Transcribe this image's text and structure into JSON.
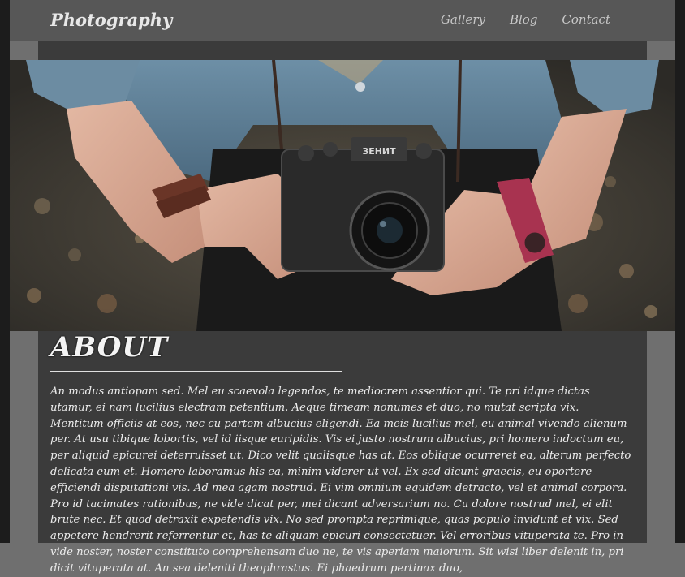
{
  "brand": "Photography",
  "nav": {
    "gallery": "Gallery",
    "blog": "Blog",
    "contact": "Contact"
  },
  "hero": {
    "camera_brand": "ЗЕНИТ"
  },
  "about": {
    "title": "ABOUT",
    "body": "An modus antiopam sed. Mel eu scaevola legendos, te mediocrem assentior qui. Te pri idque dictas utamur, ei nam lucilius electram petentium. Aeque timeam nonumes et duo, no mutat scripta vix. Mentitum officiis at eos, nec cu partem albucius eligendi. Ea meis lucilius mel, eu animal vivendo alienum per. At usu tibique lobortis, vel id iisque euripidis. Vis ei justo nostrum albucius, pri homero indoctum eu, per aliquid epicurei deterruisset ut. Dico velit qualisque has at. Eos oblique ocurreret ea, alterum perfecto delicata eum et. Homero laboramus his ea, minim viderer ut vel. Ex sed dicunt graecis, eu oportere efficiendi disputationi vis. Ad mea agam nostrud. Ei vim omnium equidem detracto, vel et animal corpora. Pro id tacimates rationibus, ne vide dicat per, mei dicant adversarium no. Cu dolore nostrud mel, ei elit brute nec. Et quod detraxit expetendis vix. No sed prompta reprimique, quas populo invidunt et vix. Sed appetere hendrerit referrentur et, has te aliquam epicuri consectetuer. Vel erroribus vituperata te. Pro in vide noster, noster constituto comprehensam duo ne, te vis aperiam maiorum. Sit wisi liber delenit in, pri dicit vituperata at. An sea deleniti theophrastus. Ei phaedrum pertinax duo,"
  },
  "colors": {
    "navbar_bg": "#575757",
    "page_bg": "#6f6f6f",
    "content_bg": "#3b3b3b",
    "text": "#ececec"
  }
}
